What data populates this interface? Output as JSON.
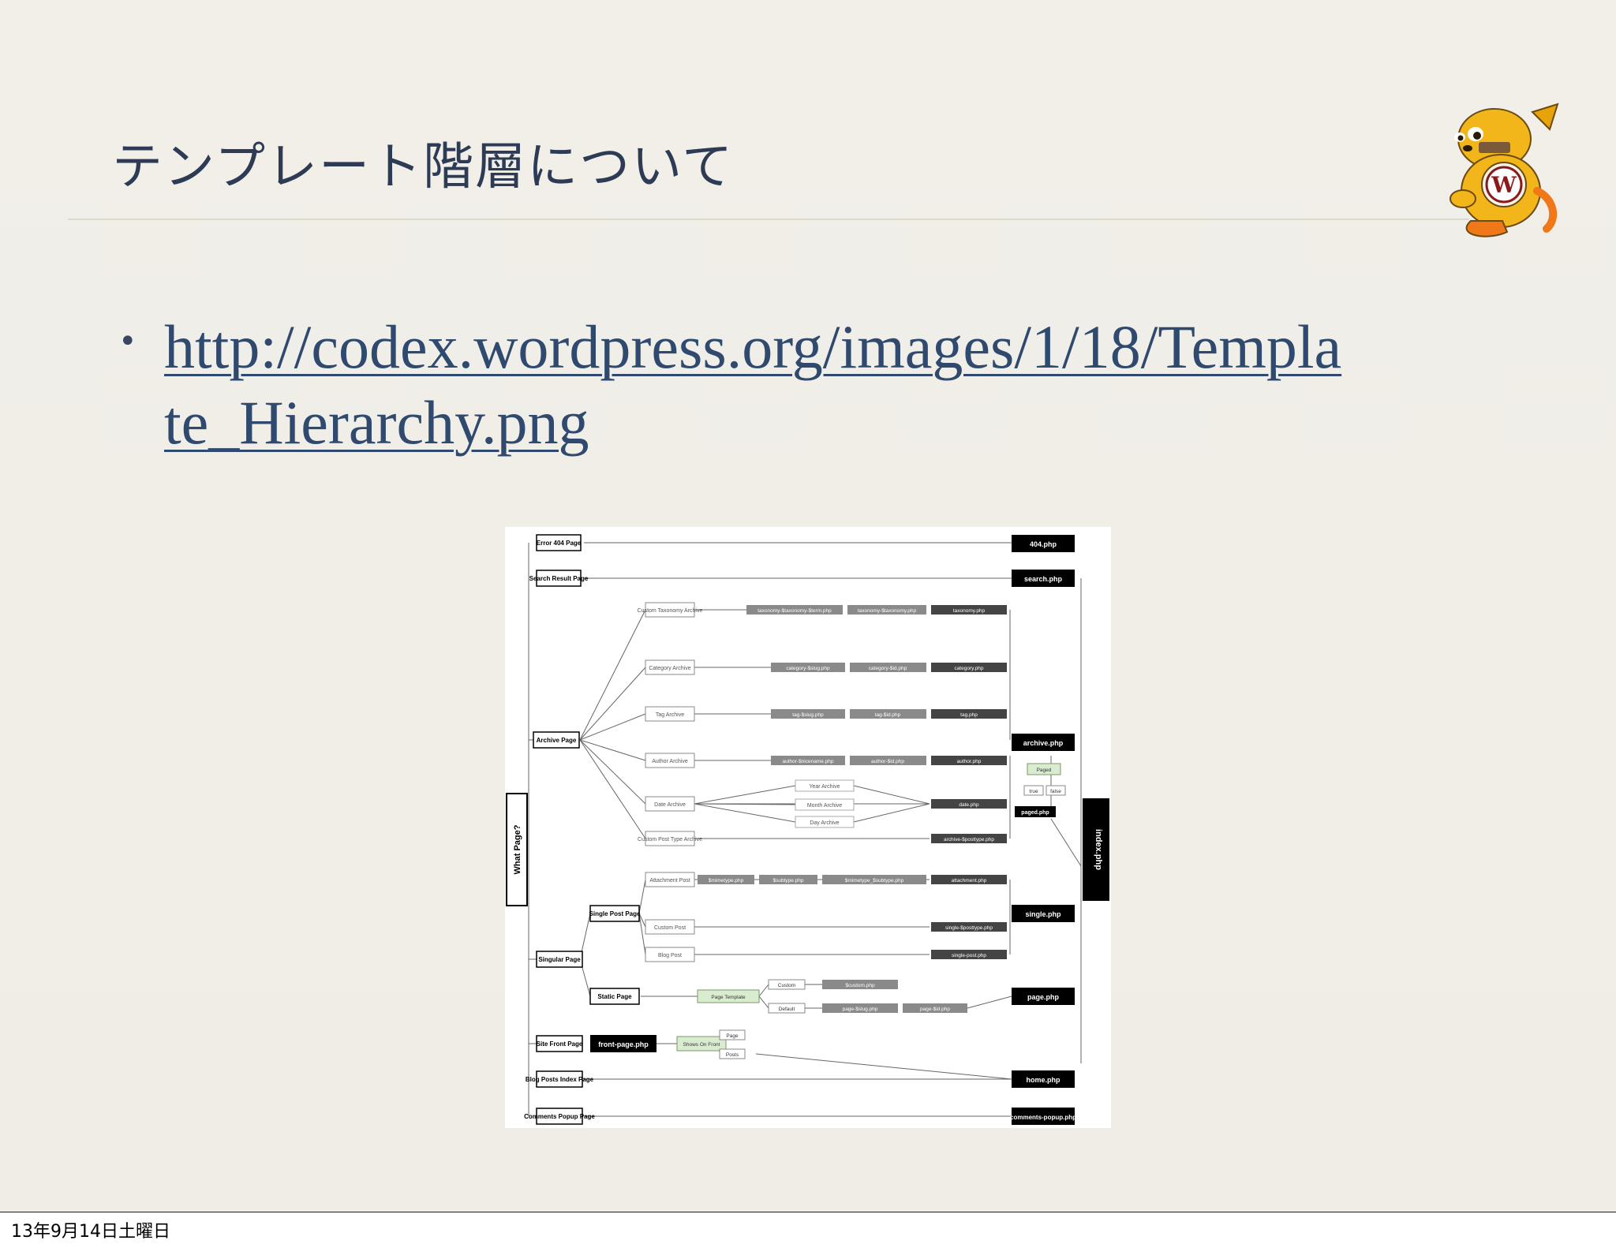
{
  "slide": {
    "title": "テンプレート階層について",
    "bullet_url": "http://codex.wordpress.org/images/1/18/Template_Hierarchy.png",
    "mascot_icon": "wapuu-wordpress-mascot"
  },
  "diagram": {
    "root_label": "What Page?",
    "page_types": {
      "error": "Error 404 Page",
      "search": "Search Result Page",
      "archive": "Archive Page",
      "singular": "Singular Page",
      "single_post": "Single Post Page",
      "static": "Static Page",
      "site_front": "Site Front Page",
      "blog_posts": "Blog Posts Index Page",
      "comments": "Comments Popup Page"
    },
    "archive_types": {
      "taxonomy": "Custom Taxonomy Archive",
      "category": "Category Archive",
      "tag": "Tag Archive",
      "author": "Author Archive",
      "date": "Date Archive",
      "post_type": "Custom Post Type Archive"
    },
    "date_types": {
      "year": "Year Archive",
      "month": "Month Archive",
      "day": "Day Archive"
    },
    "single_types": {
      "attachment": "Attachment Post",
      "custom": "Custom Post",
      "blog": "Blog Post"
    },
    "final_templates": {
      "404": "404.php",
      "search": "search.php",
      "archive": "archive.php",
      "single": "single.php",
      "page": "page.php",
      "front": "front-page.php",
      "home": "home.php",
      "comments": "comments-popup.php",
      "index": "index.php",
      "paged": "paged.php"
    },
    "templates": {
      "taxonomy": [
        "taxonomy-$taxonomy-$term.php",
        "taxonomy-$taxonomy.php",
        "taxonomy.php"
      ],
      "category": [
        "category-$slug.php",
        "category-$id.php",
        "category.php"
      ],
      "tag": [
        "tag-$slug.php",
        "tag-$id.php",
        "tag.php"
      ],
      "author": [
        "author-$nicename.php",
        "author-$id.php",
        "author.php"
      ],
      "date": "date.php",
      "post_type": "archive-$posttype.php",
      "attachment": [
        "$mimetype.php",
        "$subtype.php",
        "$mimetype_$subtype.php",
        "attachment.php"
      ],
      "custom": "single-$posttype.php",
      "blog": "single-post.php",
      "page_custom": "$custom.php",
      "page_default": [
        "page-$slug.php",
        "page-$id.php"
      ]
    },
    "labels": {
      "page_template": "Page Template",
      "custom": "Custom",
      "default": "Default",
      "paged": "Paged",
      "true": "true",
      "false": "false",
      "shows_on_front": "Shows On Front",
      "page": "Page",
      "posts": "Posts"
    }
  },
  "footer": {
    "date": "13年9月14日土曜日"
  }
}
